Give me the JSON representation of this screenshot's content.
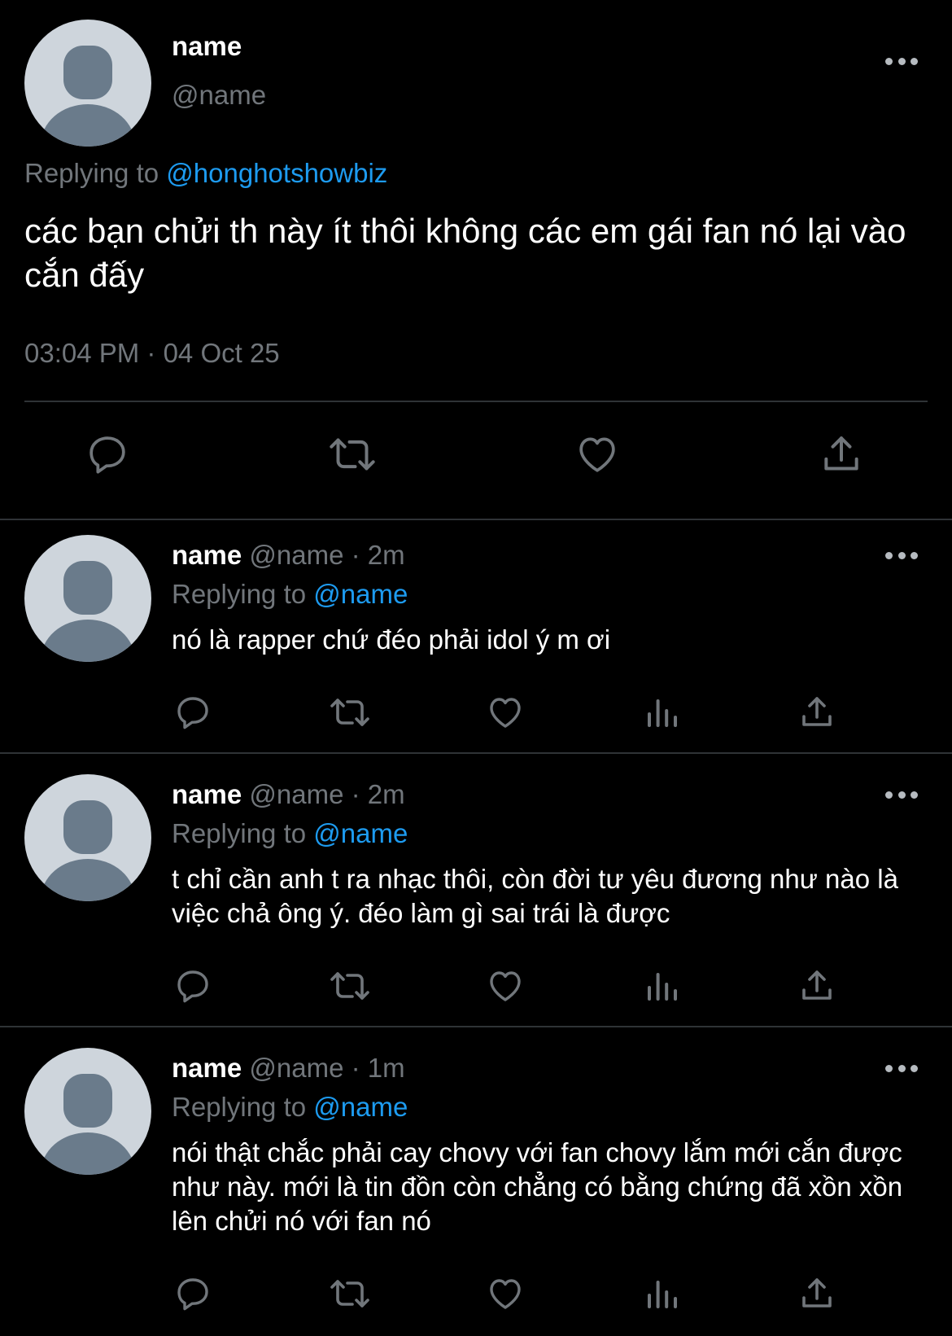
{
  "main_tweet": {
    "name": "name",
    "handle": "@name",
    "replying_label": "Replying to",
    "replying_to": "@honghotshowbiz",
    "text": "các bạn chửi th này ít thôi không các em gái fan nó lại vào cắn đấy",
    "timestamp": "03:04 PM · 04 Oct 25",
    "actions": [
      "reply-icon",
      "retweet-icon",
      "like-icon",
      "share-icon"
    ]
  },
  "replies": [
    {
      "name": "name",
      "handle": "@name",
      "time": "· 2m",
      "replying_label": "Replying to",
      "replying_to": "@name",
      "text": "nó là rapper chứ đéo phải idol ý m ơi"
    },
    {
      "name": "name",
      "handle": "@name",
      "time": "· 2m",
      "replying_label": "Replying to",
      "replying_to": "@name",
      "text": "t chỉ cần anh t ra nhạc thôi, còn đời tư yêu đương như nào là việc chả ông ý. đéo làm gì sai trái là được"
    },
    {
      "name": "name",
      "handle": "@name",
      "time": "· 1m",
      "replying_label": "Replying to",
      "replying_to": "@name",
      "text": "nói thật chắc phải cay chovy với fan chovy lắm mới cắn được như này. mới là tin đồn còn chẳng có bằng chứng đã xồn xồn lên chửi nó với fan nó"
    }
  ],
  "colors": {
    "background": "#000000",
    "text": "#ffffff",
    "secondary": "#71767b",
    "link": "#1d9bf0",
    "divider": "#2f3336"
  }
}
